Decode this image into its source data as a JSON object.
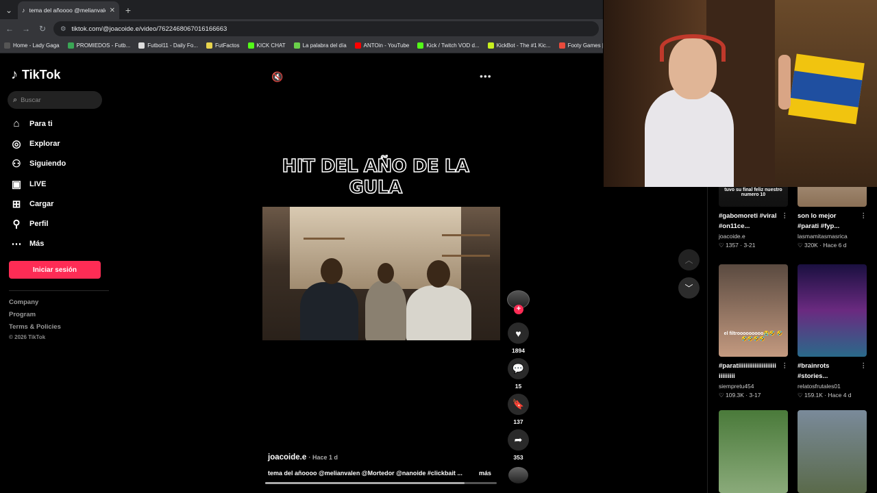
{
  "browser": {
    "tab_title": "tema del añoooo @melianvalen",
    "url": "tiktok.com/@joacoide.e/video/7622468067016166663",
    "bookmarks": [
      {
        "label": "Home - Lady Gaga",
        "color": "#555555"
      },
      {
        "label": "PROMIEDOS - Futb...",
        "color": "#3aa655"
      },
      {
        "label": "Futbol11 - Daily Fo...",
        "color": "#dddddd"
      },
      {
        "label": "FutFactos",
        "color": "#e8d44d"
      },
      {
        "label": "KICK CHAT",
        "color": "#53fc18"
      },
      {
        "label": "La palabra del día",
        "color": "#6ad04a"
      },
      {
        "label": "ANTOin - YouTube",
        "color": "#ff0000"
      },
      {
        "label": "Kick / Twitch VOD d...",
        "color": "#53fc18"
      },
      {
        "label": "KickBot - The #1 Kic...",
        "color": "#c8f01e"
      },
      {
        "label": "Footy Games | F",
        "color": "#e94b3c"
      }
    ]
  },
  "sidebar": {
    "logo": "TikTok",
    "search_placeholder": "Buscar",
    "items": [
      {
        "label": "Para ti",
        "icon": "home-icon"
      },
      {
        "label": "Explorar",
        "icon": "compass-icon"
      },
      {
        "label": "Siguiendo",
        "icon": "following-icon"
      },
      {
        "label": "LIVE",
        "icon": "live-icon"
      },
      {
        "label": "Cargar",
        "icon": "upload-icon"
      },
      {
        "label": "Perfil",
        "icon": "profile-icon"
      },
      {
        "label": "Más",
        "icon": "more-icon"
      }
    ],
    "login_label": "Iniciar sesión",
    "footer_links": [
      "Company",
      "Program",
      "Terms & Policies"
    ],
    "copyright": "© 2026 TikTok"
  },
  "video": {
    "overlay_title": "HIT DEL AÑO DE LA GULA",
    "author": "joacoide.e",
    "posted": "· Hace 1 d",
    "caption": "tema del añoooo @melianvalen @Mortedor @nanoide #clickbait ...",
    "more_label": "más",
    "likes": "1894",
    "comments": "15",
    "saves": "137",
    "shares": "353",
    "progress": 0.86
  },
  "related": [
    {
      "title": "#gabomoreti #viral #on11ce...",
      "author": "joacoide.e",
      "likes": "1357",
      "date": "3-21",
      "thumb_text": "tuvo su final feliz nuestro numero 10"
    },
    {
      "title": "son lo mejor #parati #fyp...",
      "author": "lasmamitasmasrica",
      "likes": "320K",
      "date": "Hace 6 d",
      "thumb_text": ""
    },
    {
      "title": "#paratiiiiiiiiiiiiiiiiiiiii iiiiiiiii",
      "author": "siempretu454",
      "likes": "109.3K",
      "date": "3-17",
      "thumb_text": "el filtrooooooooo😭🤣 🤣🤣🤣🤣🤣"
    },
    {
      "title": "#brainrots #stories...",
      "author": "relatosfrutales01",
      "likes": "159.1K",
      "date": "Hace 4 d",
      "thumb_text": ""
    },
    {
      "title": "",
      "author": "",
      "likes": "",
      "date": "",
      "thumb_text": ""
    },
    {
      "title": "",
      "author": "",
      "likes": "",
      "date": "",
      "thumb_text": ""
    }
  ]
}
